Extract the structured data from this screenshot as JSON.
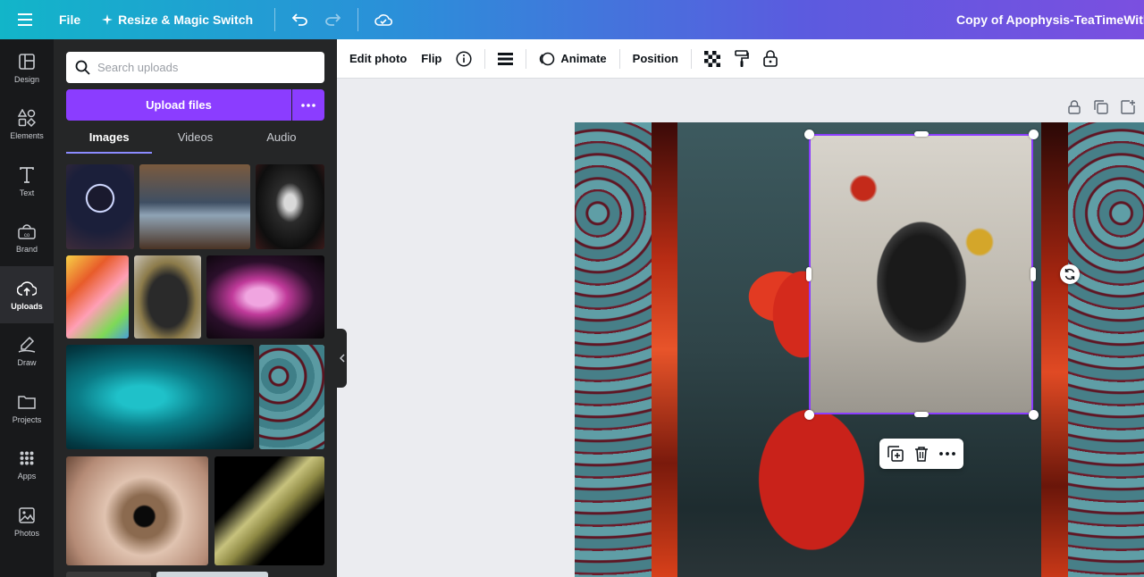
{
  "topbar": {
    "file_label": "File",
    "resize_label": "Resize & Magic Switch",
    "doc_title": "Copy of Apophysis-TeaTimeWithA"
  },
  "rail": {
    "items": [
      {
        "label": "Design",
        "icon": "design-icon"
      },
      {
        "label": "Elements",
        "icon": "elements-icon"
      },
      {
        "label": "Text",
        "icon": "text-icon"
      },
      {
        "label": "Brand",
        "icon": "brand-icon"
      },
      {
        "label": "Uploads",
        "icon": "uploads-icon",
        "active": true
      },
      {
        "label": "Draw",
        "icon": "draw-icon"
      },
      {
        "label": "Projects",
        "icon": "projects-icon"
      },
      {
        "label": "Apps",
        "icon": "apps-icon"
      },
      {
        "label": "Photos",
        "icon": "photos-icon"
      }
    ]
  },
  "panel": {
    "search_placeholder": "Search uploads",
    "upload_label": "Upload files",
    "tabs": [
      {
        "label": "Images",
        "active": true
      },
      {
        "label": "Videos"
      },
      {
        "label": "Audio"
      }
    ]
  },
  "toolbar": {
    "edit_photo": "Edit photo",
    "flip": "Flip",
    "animate": "Animate",
    "position": "Position"
  },
  "colors": {
    "accent": "#8b3dff",
    "rail_bg": "#18191b",
    "panel_bg": "#252627"
  }
}
